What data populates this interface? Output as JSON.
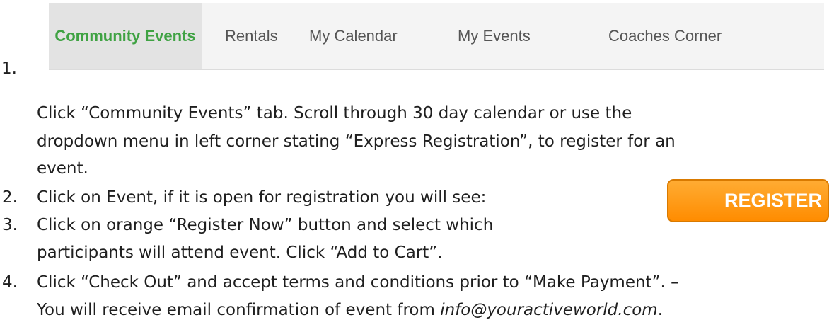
{
  "tabs": [
    {
      "label": "Community Events",
      "active": true
    },
    {
      "label": "Rentals",
      "active": false
    },
    {
      "label": "My Calendar",
      "active": false
    },
    {
      "label": "My Events",
      "active": false
    },
    {
      "label": "Coaches Corner",
      "active": false
    }
  ],
  "colors": {
    "active_tab_text": "#3fa243",
    "register_button": "#ff8c00"
  },
  "steps": [
    {
      "number": "1.",
      "lines": [
        "Click “Community Events” tab. Scroll through 30 day calendar or use the",
        "dropdown menu in left corner stating “Express Registration”, to register for an",
        "event."
      ]
    },
    {
      "number": "2.",
      "lines": [
        "Click on Event, if it is open for registration you will see:"
      ]
    },
    {
      "number": "3.",
      "lines": [
        "Click on orange “Register Now” button and select which",
        "participants will attend event. Click “Add to Cart”."
      ]
    },
    {
      "number": "4.",
      "lines": [
        "Click “Check Out” and accept terms and conditions prior to “Make Payment”. –",
        "You will receive email confirmation of event from "
      ],
      "email": "info@youractiveworld.com",
      "after_email": "."
    }
  ],
  "register_button": {
    "label": "REGISTER"
  }
}
